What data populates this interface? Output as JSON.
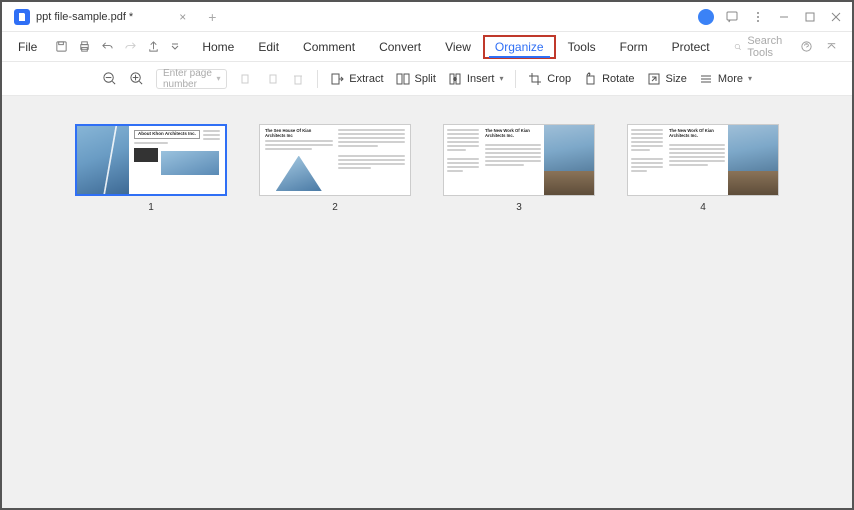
{
  "titlebar": {
    "tab_title": "ppt file-sample.pdf *"
  },
  "menubar": {
    "file_label": "File",
    "items": [
      "Home",
      "Edit",
      "Comment",
      "Convert",
      "View",
      "Organize",
      "Tools",
      "Form",
      "Protect"
    ],
    "active_index": 5,
    "search_placeholder": "Search Tools"
  },
  "toolbar": {
    "page_input_placeholder": "Enter page number",
    "extract": "Extract",
    "split": "Split",
    "insert": "Insert",
    "crop": "Crop",
    "rotate": "Rotate",
    "size": "Size",
    "more": "More"
  },
  "pages": [
    {
      "num": "1",
      "selected": true,
      "title": "About Khon Architects Inc."
    },
    {
      "num": "2",
      "selected": false,
      "title": "The Sen House Of Kian Architects Inc"
    },
    {
      "num": "3",
      "selected": false,
      "title": "The New Work Of Kian Architects Inc."
    },
    {
      "num": "4",
      "selected": false,
      "title": "The New Work Of Kian Architects Inc."
    }
  ]
}
